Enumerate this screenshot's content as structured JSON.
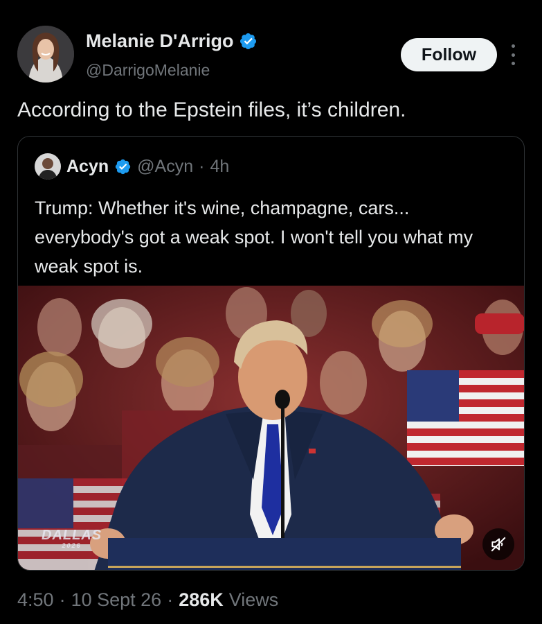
{
  "author": {
    "name": "Melanie D'Arrigo",
    "handle": "@DarrigoMelanie",
    "verified": true
  },
  "follow_button": {
    "label": "Follow"
  },
  "tweet": {
    "text": "According to the Epstein files, it’s children."
  },
  "quoted_tweet": {
    "author_name": "Acyn",
    "handle": "@Acyn",
    "separator": "·",
    "time": "4h",
    "verified": true,
    "text": "Trump: Whether it's wine, champagne, cars... everybody's got a weak spot. I won't tell you what my weak spot is.",
    "media": {
      "watermark": "DALLAS",
      "watermark_sub": "2026",
      "mute_icon": "speaker-muted-icon"
    }
  },
  "meta": {
    "time": "4:50",
    "dot1": "·",
    "date": "10 Sept 26",
    "dot2": "·",
    "views_count": "286K",
    "views_label": "Views"
  },
  "colors": {
    "background": "#000000",
    "text_primary": "#e7e9ea",
    "text_secondary": "#71767b",
    "verified_blue": "#1d9bf0",
    "border": "#2f3336",
    "follow_bg": "#eff3f4"
  }
}
